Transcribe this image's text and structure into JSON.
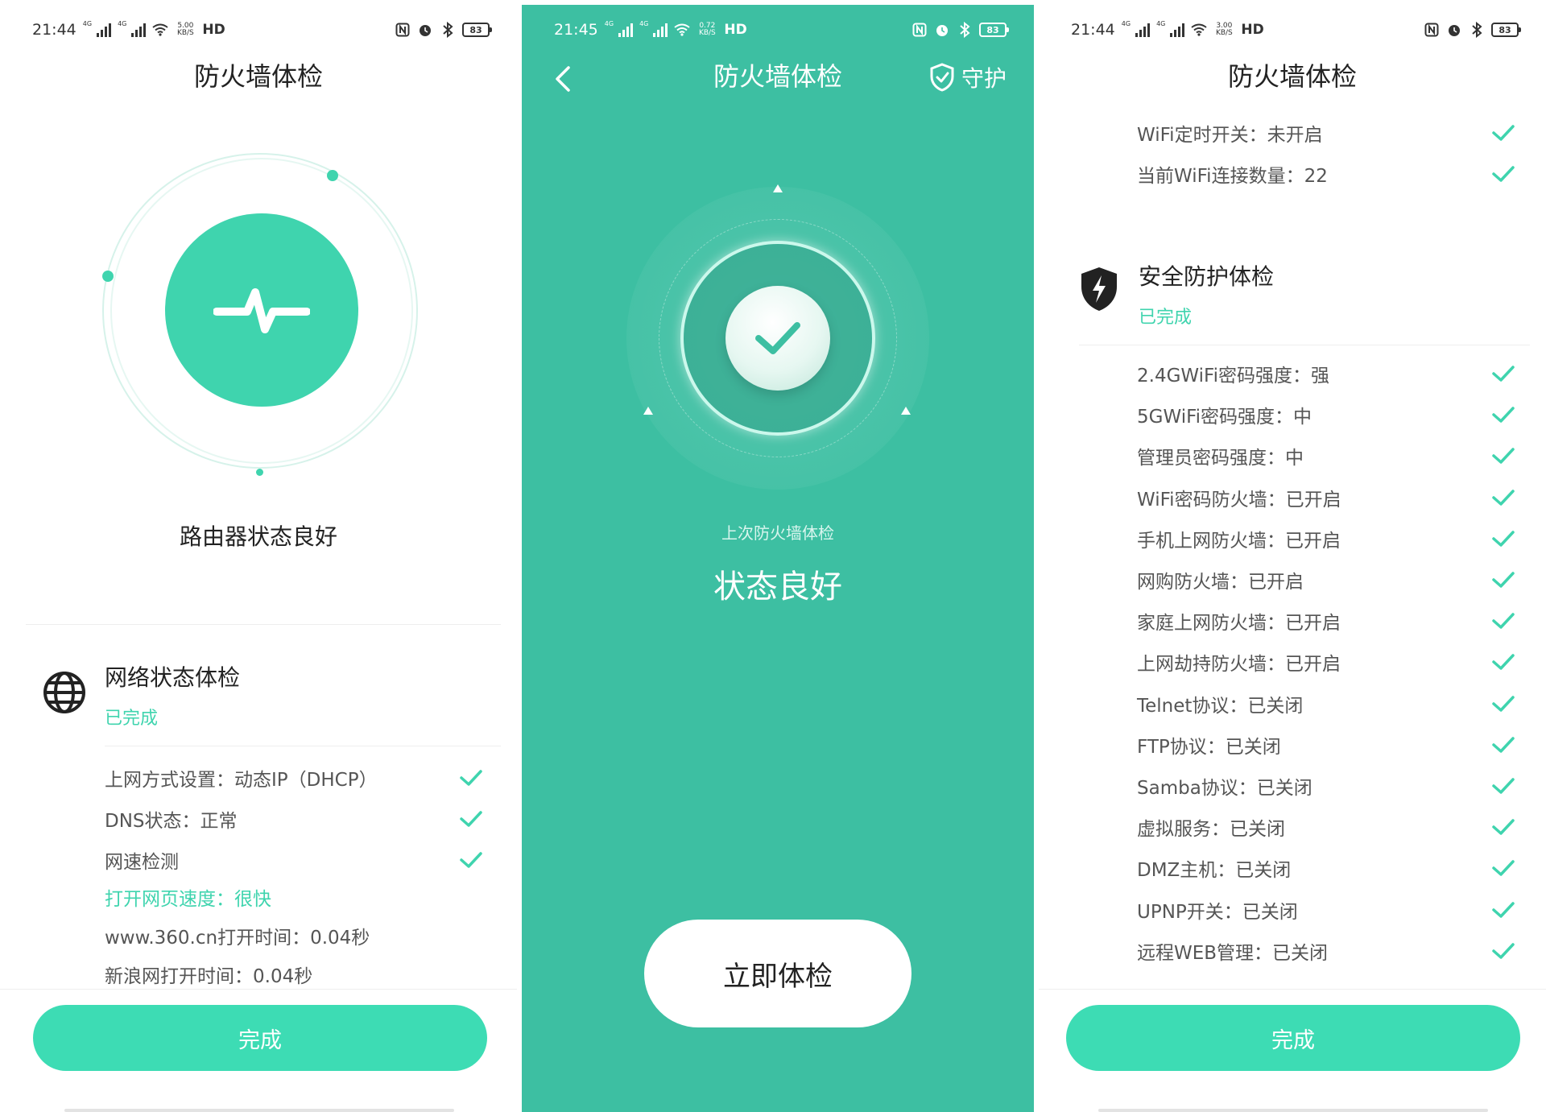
{
  "colors": {
    "accent": "#3fd4ae",
    "button": "#3ddcb4",
    "panel_bg": "#3dbfa2"
  },
  "screen1": {
    "status_bar": {
      "time": "21:44",
      "net1": "4G",
      "net2": "4G",
      "speed": "5.00 KB/S",
      "hd": "HD",
      "battery": "83"
    },
    "title": "防火墙体检",
    "router_status": "路由器状态良好",
    "section": {
      "icon": "globe-icon",
      "title": "网络状态体检",
      "status": "已完成"
    },
    "items": [
      {
        "label": "上网方式设置：动态IP（DHCP）",
        "checked": true
      },
      {
        "label": "DNS状态：正常",
        "checked": true
      },
      {
        "label": "网速检测",
        "checked": true
      }
    ],
    "speed_result": "打开网页速度：很快",
    "details": [
      "www.360.cn打开时间：0.04秒",
      "新浪网打开时间：0.04秒"
    ],
    "done_label": "完成"
  },
  "screen2": {
    "status_bar": {
      "time": "21:45",
      "net1": "4G",
      "net2": "4G",
      "speed": "0.72 KB/S",
      "hd": "HD",
      "battery": "83"
    },
    "title": "防火墙体检",
    "guard_label": "守护",
    "last_check_label": "上次防火墙体检",
    "status": "状态良好",
    "check_now_label": "立即体检"
  },
  "screen3": {
    "status_bar": {
      "time": "21:44",
      "net1": "4G",
      "net2": "4G",
      "speed": "3.00 KB/S",
      "hd": "HD",
      "battery": "83"
    },
    "title": "防火墙体检",
    "top_items": [
      {
        "label": "WiFi定时开关：未开启",
        "checked": true
      },
      {
        "label": "当前WiFi连接数量：22",
        "checked": true
      }
    ],
    "section": {
      "icon": "shield-bolt-icon",
      "title": "安全防护体检",
      "status": "已完成"
    },
    "items": [
      {
        "label": "2.4GWiFi密码强度：强",
        "checked": true
      },
      {
        "label": "5GWiFi密码强度：中",
        "checked": true
      },
      {
        "label": "管理员密码强度：中",
        "checked": true
      },
      {
        "label": "WiFi密码防火墙：已开启",
        "checked": true
      },
      {
        "label": "手机上网防火墙：已开启",
        "checked": true
      },
      {
        "label": "网购防火墙：已开启",
        "checked": true
      },
      {
        "label": "家庭上网防火墙：已开启",
        "checked": true
      },
      {
        "label": "上网劫持防火墙：已开启",
        "checked": true
      },
      {
        "label": "Telnet协议：已关闭",
        "checked": true
      },
      {
        "label": "FTP协议：已关闭",
        "checked": true
      },
      {
        "label": "Samba协议：已关闭",
        "checked": true
      },
      {
        "label": "虚拟服务：已关闭",
        "checked": true
      },
      {
        "label": "DMZ主机：已关闭",
        "checked": true
      },
      {
        "label": "UPNP开关：已关闭",
        "checked": true
      },
      {
        "label": "远程WEB管理：已关闭",
        "checked": true
      }
    ],
    "done_label": "完成"
  }
}
